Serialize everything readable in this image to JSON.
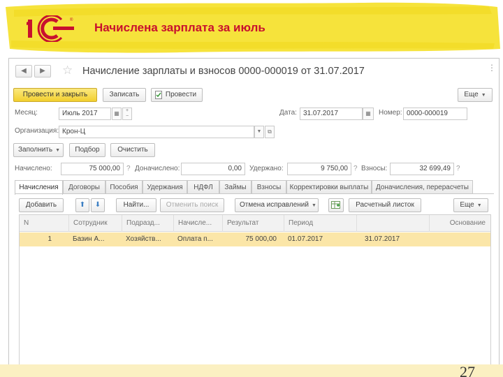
{
  "banner": {
    "title": "Начислена зарплата за июль",
    "logo_text": "1С",
    "highlight_color": "#f5e13a",
    "title_color": "#c8102e",
    "logo_color": "#c8102e"
  },
  "page_number": "27",
  "window": {
    "nav": {
      "back_icon": "◀",
      "forward_icon": "▶"
    },
    "star_icon": "☆",
    "title": "Начисление зарплаты и взносов 0000-000019 от 31.07.2017",
    "menu_icon": "⋮",
    "toolbar": {
      "post_close": "Провести и закрыть",
      "save": "Записать",
      "post": "Провести",
      "more": "Еще"
    },
    "form": {
      "month_label": "Месяц:",
      "month_value": "Июль 2017",
      "date_label": "Дата:",
      "date_value": "31.07.2017",
      "number_label": "Номер:",
      "number_value": "0000-000019",
      "org_label": "Организация:",
      "org_value": "Крон-Ц",
      "fill": "Заполнить",
      "select": "Подбор",
      "clear": "Очистить",
      "accrued_label": "Начислено:",
      "accrued_value": "75 000,00",
      "additional_label": "Доначислено:",
      "additional_value": "0,00",
      "withheld_label": "Удержано:",
      "withheld_value": "9 750,00",
      "contrib_label": "Взносы:",
      "contrib_value": "32 699,49",
      "qmark": "?"
    },
    "tabs": [
      "Начисления",
      "Договоры",
      "Пособия",
      "Удержания",
      "НДФЛ",
      "Займы",
      "Взносы",
      "Корректировки выплаты",
      "Доначисления, перерасчеты"
    ],
    "active_tab": "Начисления",
    "table_toolbar": {
      "add": "Добавить",
      "up_icon": "⬆",
      "down_icon": "⬇",
      "find": "Найти...",
      "cancel_search": "Отменить поиск",
      "cancel_corrections": "Отмена исправлений",
      "payslip": "Расчетный листок",
      "more": "Еще"
    },
    "table": {
      "columns": [
        "N",
        "Сотрудник",
        "Подразд...",
        "Начисле...",
        "Результат",
        "Период",
        "",
        "Основание"
      ],
      "rows": [
        [
          "1",
          "Базин А...",
          "Хозяйств...",
          "Оплата п...",
          "75 000,00",
          "01.07.2017",
          "31.07.2017",
          ""
        ]
      ],
      "selected_row_color": "#fbe6a8"
    }
  }
}
